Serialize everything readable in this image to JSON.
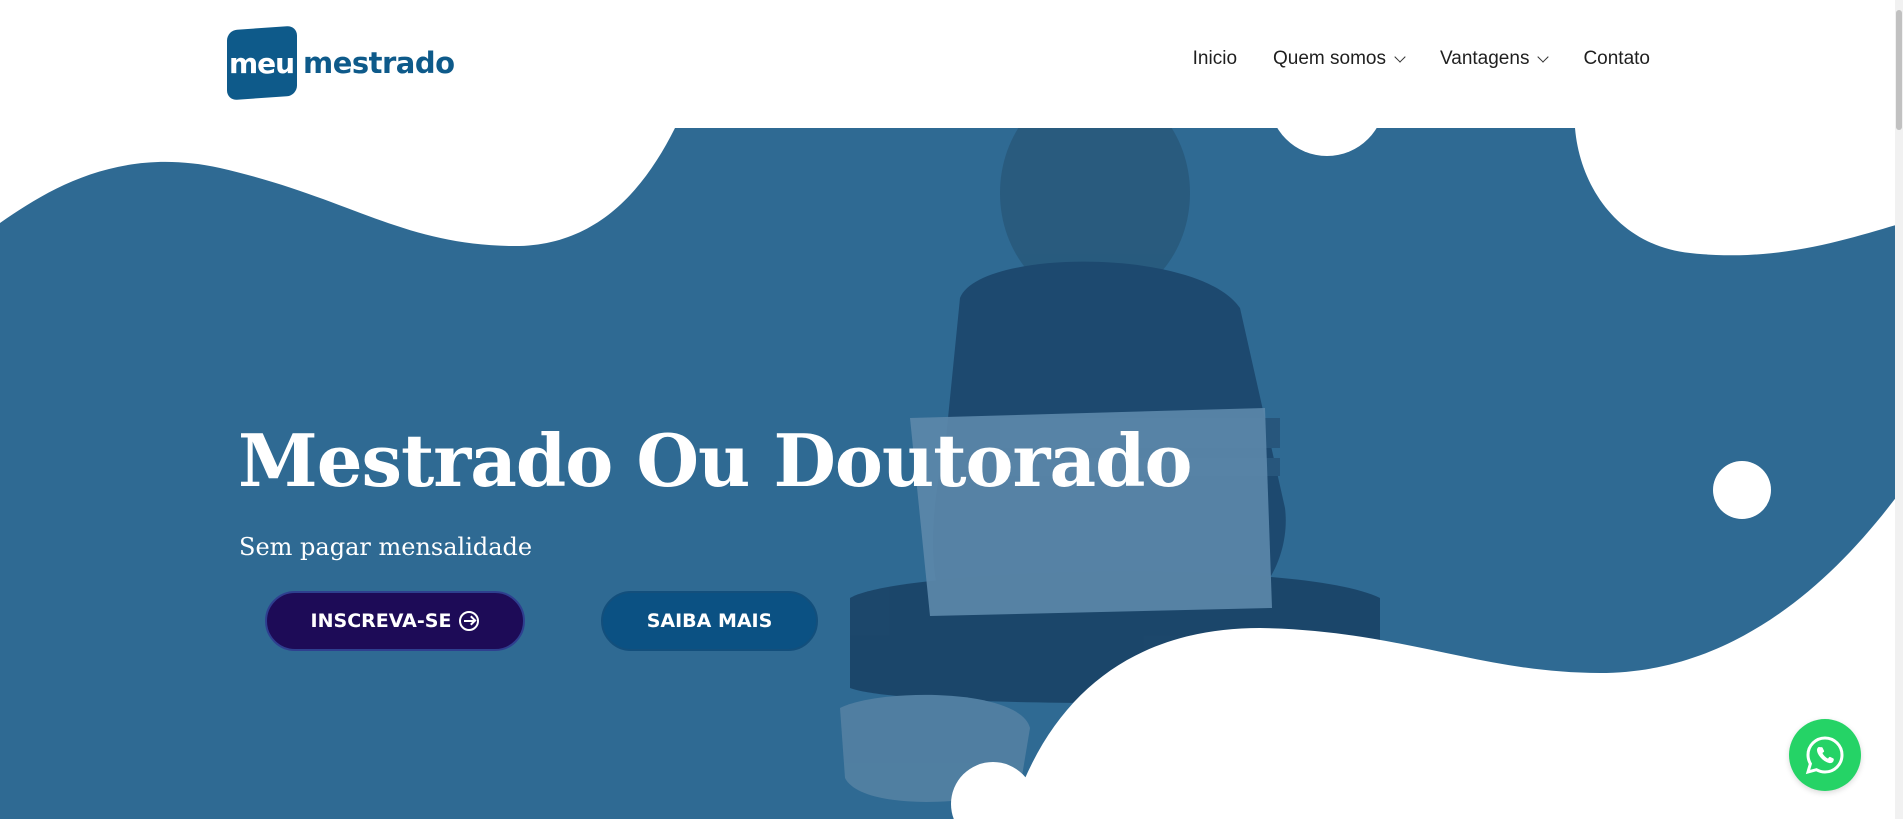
{
  "logo": {
    "badge_text": "meu",
    "text": "mestrado",
    "brand_color": "#0e5a8a"
  },
  "nav": {
    "items": [
      {
        "label": "Inicio",
        "has_dropdown": false
      },
      {
        "label": "Quem somos",
        "has_dropdown": true
      },
      {
        "label": "Vantagens",
        "has_dropdown": true
      },
      {
        "label": "Contato",
        "has_dropdown": false
      }
    ]
  },
  "hero": {
    "title": "Mestrado Ou Doutorado",
    "subtitle": "Sem pagar mensalidade",
    "primary_button": "INSCREVA-SE",
    "secondary_button": "SAIBA MAIS",
    "overlay_color": "#2f6a93"
  },
  "colors": {
    "primary_button": "#1d0b57",
    "secondary_button": "#0b5183",
    "whatsapp": "#25d366"
  },
  "icons": {
    "whatsapp": "whatsapp-icon",
    "arrow": "arrow-circle-right-icon",
    "chevron": "chevron-down-icon"
  }
}
